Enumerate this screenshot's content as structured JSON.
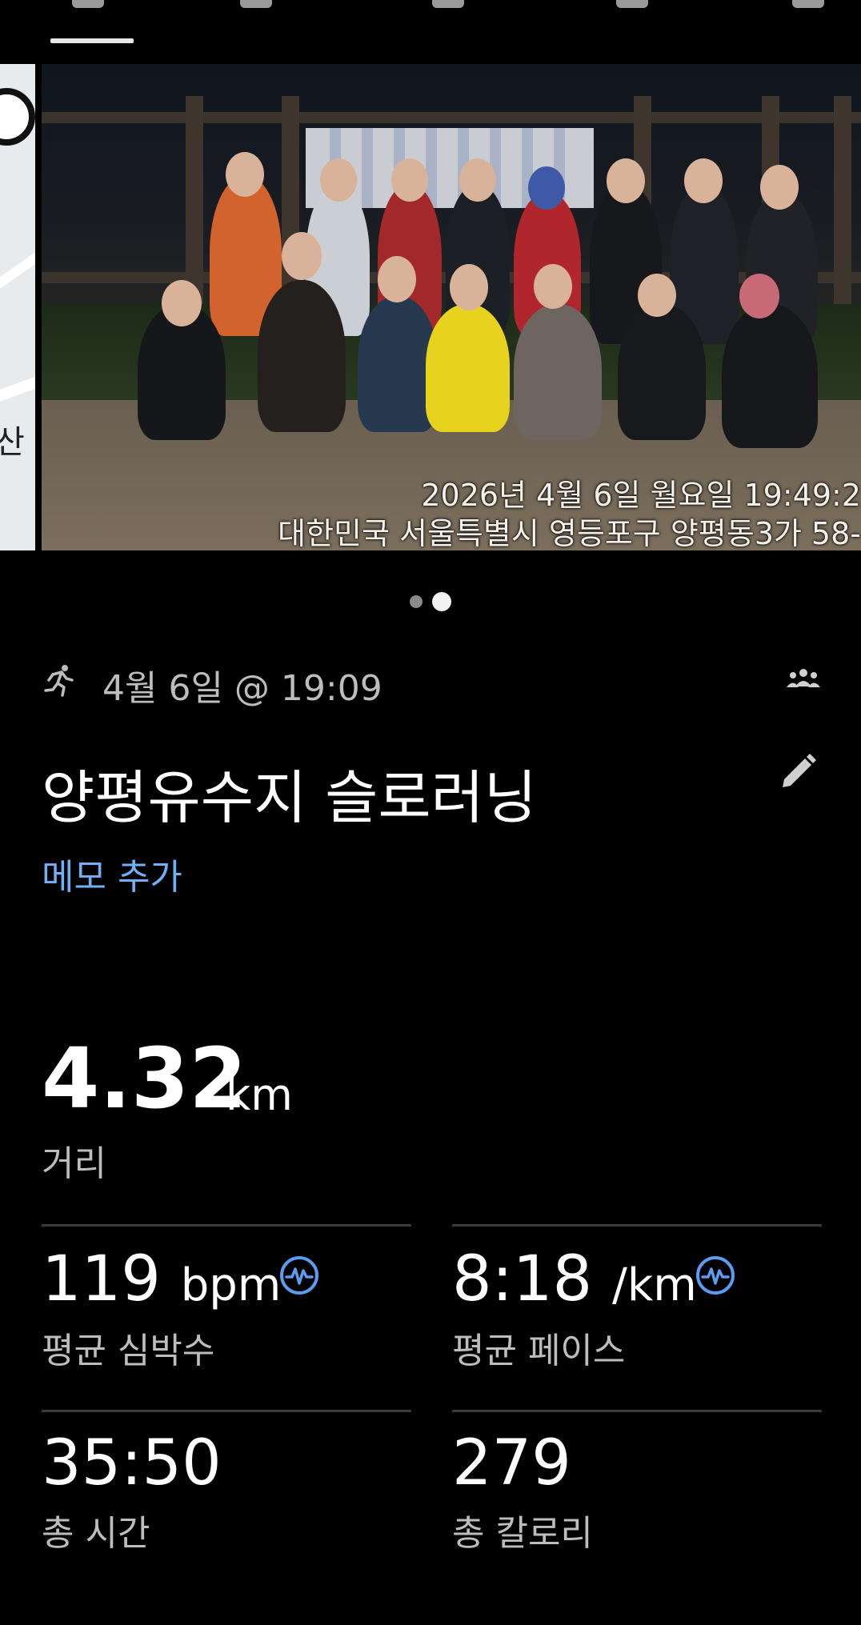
{
  "activity": {
    "date_time": "4월 6일 @ 19:09",
    "title": "양평유수지 슬로러닝",
    "memo_link": "메모 추가"
  },
  "photo": {
    "timestamp": "2026년 4월 6일 월요일 19:49:2",
    "location": "대한민국 서울특별시 영등포구 양평동3가 58-"
  },
  "map": {
    "visible_text": "산"
  },
  "carousel": {
    "page_count": 2,
    "active_index": 1
  },
  "distance": {
    "value": "4.32",
    "unit": "km",
    "label": "거리"
  },
  "stats": {
    "heart_rate": {
      "value": "119",
      "unit": "bpm",
      "label": "평균 심박수",
      "icon": "heart-rate-icon"
    },
    "pace": {
      "value": "8:18",
      "unit": "/km",
      "label": "평균 페이스",
      "icon": "heart-rate-icon"
    },
    "total_time": {
      "value": "35:50",
      "label": "총 시간"
    },
    "calories": {
      "value": "279",
      "label": "총 칼로리"
    }
  },
  "colors": {
    "background": "#000000",
    "link": "#6fb0f7",
    "label": "#bdbdbd",
    "icon_accent": "#5b9bf0"
  },
  "icons": [
    "running-icon",
    "group-icon",
    "edit-icon",
    "heart-rate-icon"
  ]
}
